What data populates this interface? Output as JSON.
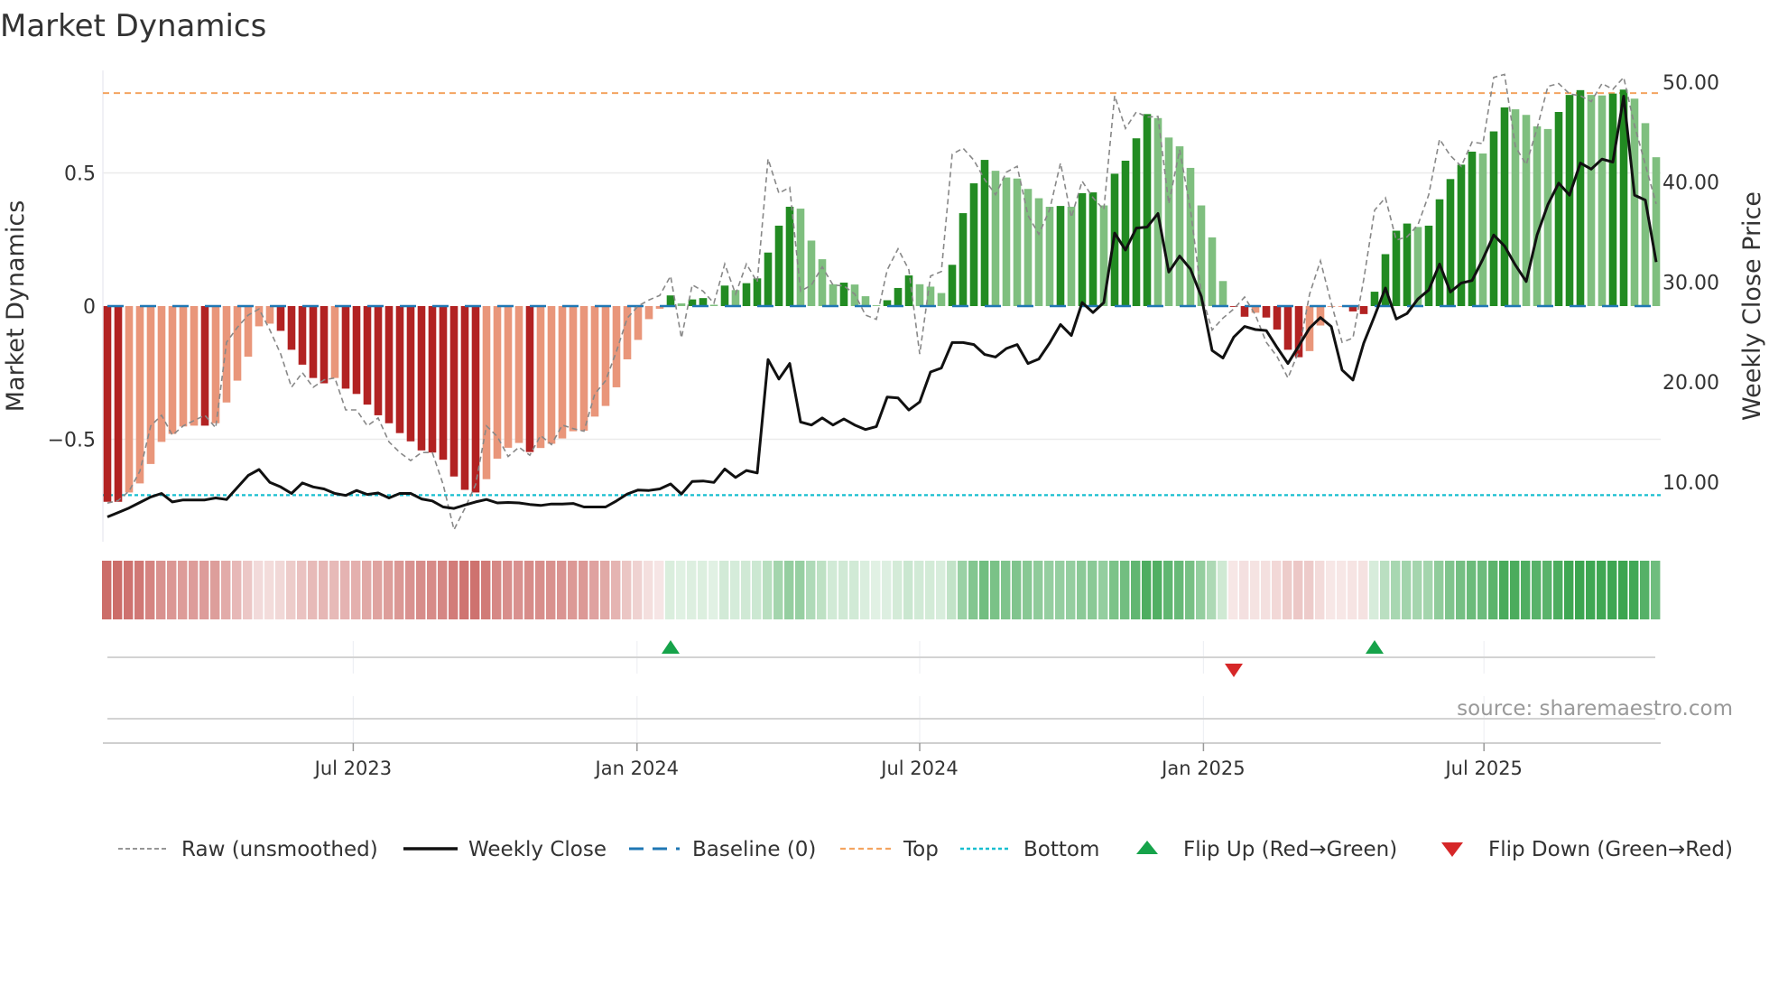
{
  "chart_data": {
    "type": "bar",
    "title": "Market Dynamics",
    "ylabel": "Market Dynamics",
    "y2label": "Weekly Close Price",
    "ylim": [
      -0.885,
      0.885
    ],
    "y2lim": [
      4.02,
      51.17
    ],
    "yticks": [
      {
        "value": 0.5,
        "label": "0.5"
      },
      {
        "value": 0,
        "label": "0"
      },
      {
        "value": -0.5,
        "label": "−0.5"
      }
    ],
    "y2ticks": [
      {
        "value": 50,
        "label": "50.00"
      },
      {
        "value": 40,
        "label": "40.00"
      },
      {
        "value": 30,
        "label": "30.00"
      },
      {
        "value": 20,
        "label": "20.00"
      },
      {
        "value": 10,
        "label": "10.00"
      }
    ],
    "x_unit": "week index (0 = late Jan 2023)",
    "xticks": [
      {
        "week": 22.7,
        "label": "Jul 2023"
      },
      {
        "week": 48.9,
        "label": "Jan 2024"
      },
      {
        "week": 75.0,
        "label": "Jul 2024"
      },
      {
        "week": 101.2,
        "label": "Jan 2025"
      },
      {
        "week": 127.1,
        "label": "Jul 2025"
      }
    ],
    "reference_lines": {
      "baseline": 0,
      "top": 0.8,
      "bottom": -0.71
    },
    "momentum": [
      -0.735,
      -0.735,
      -0.7,
      -0.666,
      -0.593,
      -0.51,
      -0.48,
      -0.452,
      -0.449,
      -0.449,
      -0.44,
      -0.362,
      -0.28,
      -0.19,
      -0.076,
      -0.066,
      -0.093,
      -0.164,
      -0.22,
      -0.27,
      -0.29,
      -0.27,
      -0.31,
      -0.33,
      -0.37,
      -0.41,
      -0.44,
      -0.477,
      -0.508,
      -0.542,
      -0.55,
      -0.577,
      -0.64,
      -0.69,
      -0.7,
      -0.65,
      -0.573,
      -0.532,
      -0.514,
      -0.548,
      -0.533,
      -0.517,
      -0.497,
      -0.47,
      -0.468,
      -0.415,
      -0.375,
      -0.305,
      -0.2,
      -0.127,
      -0.049,
      -0.01,
      0.04,
      0.01,
      0.025,
      0.03,
      0.005,
      0.077,
      0.06,
      0.086,
      0.104,
      0.201,
      0.302,
      0.373,
      0.366,
      0.246,
      0.176,
      0.082,
      0.088,
      0.081,
      0.037,
      0.003,
      0.022,
      0.068,
      0.115,
      0.082,
      0.073,
      0.049,
      0.155,
      0.349,
      0.461,
      0.549,
      0.508,
      0.483,
      0.479,
      0.44,
      0.405,
      0.373,
      0.376,
      0.373,
      0.424,
      0.427,
      0.378,
      0.497,
      0.546,
      0.63,
      0.721,
      0.706,
      0.633,
      0.6,
      0.519,
      0.378,
      0.258,
      0.094,
      -0.003,
      -0.04,
      -0.025,
      -0.043,
      -0.088,
      -0.164,
      -0.192,
      -0.169,
      -0.073,
      -0.003,
      -0.001,
      -0.02,
      -0.03,
      0.054,
      0.195,
      0.283,
      0.31,
      0.297,
      0.302,
      0.401,
      0.477,
      0.531,
      0.58,
      0.573,
      0.656,
      0.746,
      0.739,
      0.718,
      0.675,
      0.665,
      0.729,
      0.793,
      0.811,
      0.793,
      0.791,
      0.798,
      0.813,
      0.779,
      0.687,
      0.559
    ],
    "raw": [
      -0.74,
      -0.73,
      -0.695,
      -0.62,
      -0.45,
      -0.41,
      -0.485,
      -0.45,
      -0.43,
      -0.41,
      -0.457,
      -0.136,
      -0.08,
      -0.034,
      -0.011,
      -0.09,
      -0.18,
      -0.305,
      -0.25,
      -0.305,
      -0.277,
      -0.27,
      -0.39,
      -0.39,
      -0.45,
      -0.42,
      -0.51,
      -0.55,
      -0.58,
      -0.55,
      -0.55,
      -0.67,
      -0.84,
      -0.76,
      -0.67,
      -0.45,
      -0.49,
      -0.565,
      -0.53,
      -0.56,
      -0.486,
      -0.52,
      -0.447,
      -0.46,
      -0.47,
      -0.33,
      -0.28,
      -0.17,
      -0.045,
      0.0,
      0.023,
      0.04,
      0.113,
      -0.12,
      0.08,
      0.056,
      0.011,
      0.158,
      0.045,
      0.158,
      0.09,
      0.553,
      0.424,
      0.446,
      0.056,
      0.079,
      0.147,
      0.079,
      0.076,
      0.045,
      -0.034,
      -0.05,
      0.136,
      0.215,
      0.136,
      -0.18,
      0.113,
      0.13,
      0.57,
      0.593,
      0.548,
      0.475,
      0.418,
      0.503,
      0.525,
      0.34,
      0.27,
      0.362,
      0.537,
      0.333,
      0.469,
      0.407,
      0.362,
      0.79,
      0.667,
      0.729,
      0.71,
      0.712,
      0.384,
      0.587,
      0.362,
      0.045,
      -0.09,
      -0.045,
      -0.011,
      0.034,
      -0.034,
      -0.136,
      -0.19,
      -0.27,
      -0.17,
      0.045,
      0.17,
      0.011,
      -0.136,
      -0.12,
      0.1,
      0.36,
      0.407,
      0.248,
      0.26,
      0.305,
      0.418,
      0.627,
      0.565,
      0.525,
      0.616,
      0.61,
      0.859,
      0.87,
      0.599,
      0.531,
      0.667,
      0.825,
      0.836,
      0.797,
      0.79,
      0.768,
      0.836,
      0.814,
      0.859,
      0.678,
      0.531,
      0.384
    ],
    "weekly_close": [
      6.5,
      6.95,
      7.4,
      7.95,
      8.5,
      8.85,
      8.0,
      8.2,
      8.2,
      8.2,
      8.4,
      8.25,
      9.45,
      10.65,
      11.25,
      9.95,
      9.5,
      8.85,
      9.9,
      9.5,
      9.3,
      8.85,
      8.65,
      9.15,
      8.75,
      8.9,
      8.4,
      8.85,
      8.85,
      8.3,
      8.1,
      7.5,
      7.35,
      7.7,
      8.0,
      8.25,
      7.9,
      7.95,
      7.9,
      7.75,
      7.65,
      7.8,
      7.8,
      7.85,
      7.5,
      7.5,
      7.5,
      8.1,
      8.8,
      9.2,
      9.15,
      9.3,
      9.8,
      8.8,
      10.05,
      10.1,
      9.95,
      11.3,
      10.45,
      11.15,
      10.9,
      22.25,
      20.3,
      21.85,
      16.0,
      15.7,
      16.4,
      15.7,
      16.3,
      15.7,
      15.25,
      15.55,
      18.5,
      18.4,
      17.2,
      18.0,
      21.0,
      21.4,
      23.95,
      23.95,
      23.75,
      22.75,
      22.5,
      23.35,
      23.75,
      21.85,
      22.3,
      23.9,
      25.75,
      24.65,
      27.95,
      26.95,
      27.95,
      34.9,
      33.2,
      35.4,
      35.5,
      36.85,
      31.0,
      32.6,
      31.3,
      28.55,
      23.15,
      22.4,
      24.5,
      25.55,
      25.25,
      25.15,
      23.45,
      21.85,
      23.6,
      25.4,
      26.45,
      25.55,
      21.2,
      20.2,
      23.9,
      26.6,
      29.4,
      26.3,
      26.85,
      28.3,
      29.2,
      31.8,
      29.0,
      29.9,
      30.15,
      32.3,
      34.7,
      33.6,
      31.7,
      30.05,
      34.7,
      37.75,
      39.9,
      38.7,
      41.9,
      41.3,
      42.3,
      42.0,
      48.6,
      38.7,
      38.2,
      32.0
    ],
    "flips": [
      {
        "week": 52,
        "type": "up"
      },
      {
        "week": 104,
        "type": "down"
      },
      {
        "week": 117,
        "type": "up"
      }
    ],
    "legend": {
      "placement": "bottom",
      "entries": [
        {
          "key": "raw",
          "label": "Raw (unsmoothed)"
        },
        {
          "key": "close",
          "label": "Weekly Close"
        },
        {
          "key": "baseline",
          "label": "Baseline (0)"
        },
        {
          "key": "top",
          "label": "Top"
        },
        {
          "key": "bottom",
          "label": "Bottom"
        },
        {
          "key": "flip_up",
          "label": "Flip Up (Red→Green)"
        },
        {
          "key": "flip_down",
          "label": "Flip Down (Green→Red)"
        }
      ]
    },
    "source": "source: sharemaestro.com",
    "colors": {
      "bar_neg_strong": "#b22222",
      "bar_neg_weak": "#e9967a",
      "bar_pos_strong": "#228b22",
      "bar_pos_weak": "#7fbf7f",
      "strip_red": "#c8605c",
      "strip_green": "#3ca550",
      "raw": "#888888",
      "close": "#111111",
      "baseline": "#1f77b4",
      "top": "#f4a460",
      "bottom": "#17becf",
      "flip_up": "#16a34a",
      "flip_down": "#d62728",
      "grid": "#ebebeb",
      "source": "#999999"
    }
  }
}
